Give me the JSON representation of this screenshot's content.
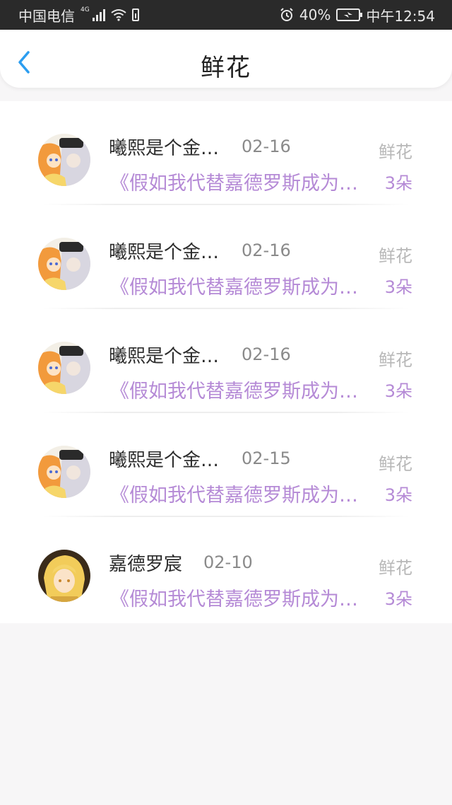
{
  "status_bar": {
    "carrier": "中国电信",
    "network": "4G",
    "battery_percent": "40%",
    "time": "中午12:54"
  },
  "header": {
    "title": "鲜花",
    "back_icon": "chevron-left-icon",
    "accent_color": "#2b9df0"
  },
  "list": {
    "items": [
      {
        "name": "曦熙是个金…",
        "date": "02-16",
        "gift": "鲜花",
        "work": "《假如我代替嘉德罗斯成为…",
        "count": "3朵",
        "avatar": "anime-duo-avatar"
      },
      {
        "name": "曦熙是个金…",
        "date": "02-16",
        "gift": "鲜花",
        "work": "《假如我代替嘉德罗斯成为…",
        "count": "3朵",
        "avatar": "anime-duo-avatar"
      },
      {
        "name": "曦熙是个金…",
        "date": "02-16",
        "gift": "鲜花",
        "work": "《假如我代替嘉德罗斯成为…",
        "count": "3朵",
        "avatar": "anime-duo-avatar"
      },
      {
        "name": "曦熙是个金…",
        "date": "02-15",
        "gift": "鲜花",
        "work": "《假如我代替嘉德罗斯成为…",
        "count": "3朵",
        "avatar": "anime-duo-avatar"
      },
      {
        "name": "嘉德罗宸",
        "date": "02-10",
        "gift": "鲜花",
        "work": "《假如我代替嘉德罗斯成为…",
        "count": "3朵",
        "avatar": "anime-blonde-avatar"
      }
    ]
  },
  "colors": {
    "title_text": "#222222",
    "work_text": "#b58ad6",
    "muted_text": "#b8b8b8"
  }
}
